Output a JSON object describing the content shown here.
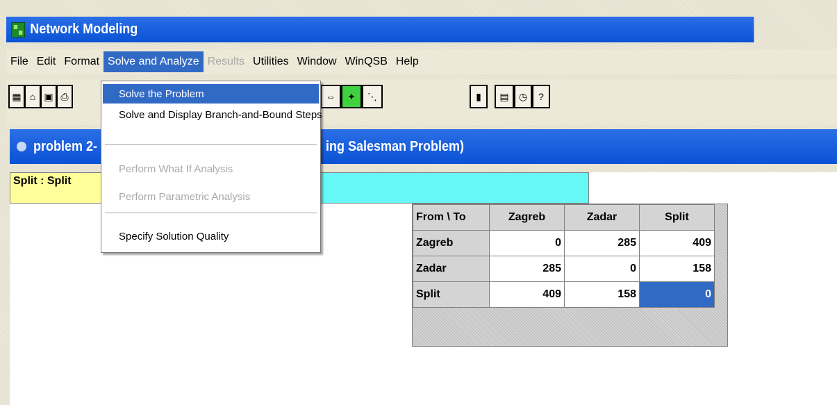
{
  "app": {
    "title": "Network Modeling",
    "icon": "network-icon"
  },
  "menubar": {
    "items": [
      {
        "label": "File",
        "state": "normal"
      },
      {
        "label": "Edit",
        "state": "normal"
      },
      {
        "label": "Format",
        "state": "normal"
      },
      {
        "label": "Solve and Analyze",
        "state": "open"
      },
      {
        "label": "Results",
        "state": "disabled"
      },
      {
        "label": "Utilities",
        "state": "normal"
      },
      {
        "label": "Window",
        "state": "normal"
      },
      {
        "label": "WinQSB",
        "state": "normal"
      },
      {
        "label": "Help",
        "state": "normal"
      }
    ]
  },
  "toolbar": {
    "buttons": [
      "new-icon",
      "open-icon",
      "save-icon",
      "print-icon",
      "resize-icon",
      "run-icon",
      "network-graph-icon",
      "chart-icon",
      "calculator-icon",
      "clock-icon",
      "help-icon"
    ]
  },
  "dropdown": {
    "items": [
      {
        "label": "Solve the Problem",
        "state": "active"
      },
      {
        "label": "Solve and Display Branch-and-Bound Steps",
        "state": "normal"
      },
      {
        "label": "Perform What If Analysis",
        "state": "disabled"
      },
      {
        "label": "Perform Parametric Analysis",
        "state": "disabled"
      },
      {
        "label": "Specify Solution Quality",
        "state": "normal"
      }
    ]
  },
  "document": {
    "title_left": "problem 2-",
    "title_right": "ing Salesman Problem)",
    "icon": "document-icon"
  },
  "cellbar": {
    "reference": "Split : Split",
    "value": ""
  },
  "grid": {
    "corner": "From \\ To",
    "columns": [
      "Zagreb",
      "Zadar",
      "Split"
    ],
    "rows": [
      {
        "label": "Zagreb",
        "values": [
          "0",
          "285",
          "409"
        ]
      },
      {
        "label": "Zadar",
        "values": [
          "285",
          "0",
          "158"
        ]
      },
      {
        "label": "Split",
        "values": [
          "409",
          "158",
          "0"
        ]
      }
    ]
  },
  "colors": {
    "title_bar": "#0a52d6",
    "menu_highlight": "#316ac5",
    "cell_reference": "#ffff99",
    "cell_input": "#66f7f7",
    "grid_header": "#d4d4d4"
  }
}
